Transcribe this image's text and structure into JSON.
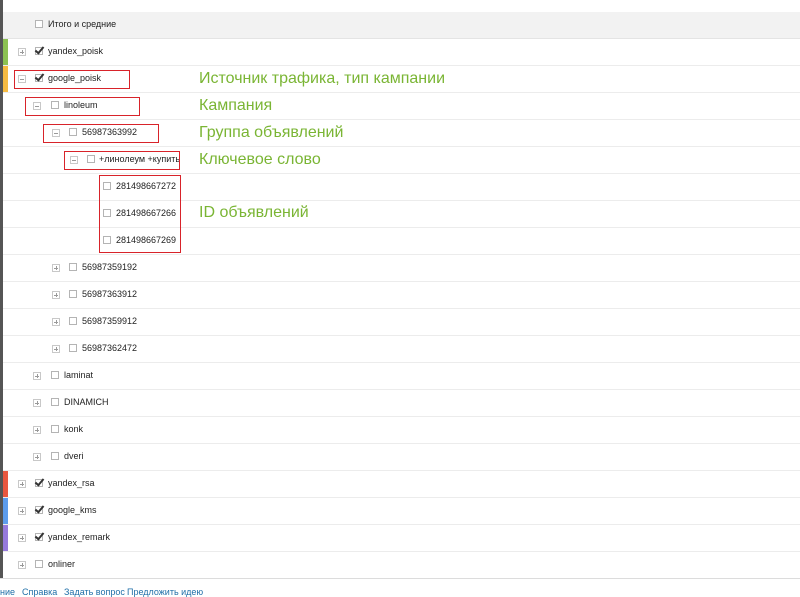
{
  "header": {
    "label": "Итого и средние",
    "checked": false
  },
  "rows": [
    {
      "id": "yandex_poisk",
      "label": "yandex_poisk",
      "level": 0,
      "expander": "plus",
      "checked": true,
      "color": "#8cc152"
    },
    {
      "id": "google_poisk",
      "label": "google_poisk",
      "level": 0,
      "expander": "minus",
      "checked": true,
      "color": "#f6bb42"
    },
    {
      "id": "linoleum",
      "label": "linoleum",
      "level": 1,
      "expander": "minus",
      "checked": false
    },
    {
      "id": "56987363992",
      "label": "56987363992",
      "level": 2,
      "expander": "minus",
      "checked": false
    },
    {
      "id": "kw",
      "label": "+линолеум +купить",
      "level": 3,
      "expander": "minus",
      "checked": false
    },
    {
      "id": "281498667272",
      "label": "281498667272",
      "level": 4,
      "expander": "none",
      "checked": false
    },
    {
      "id": "281498667266",
      "label": "281498667266",
      "level": 4,
      "expander": "none",
      "checked": false
    },
    {
      "id": "281498667269",
      "label": "281498667269",
      "level": 4,
      "expander": "none",
      "checked": false
    },
    {
      "id": "56987359192",
      "label": "56987359192",
      "level": 2,
      "expander": "plus",
      "checked": false
    },
    {
      "id": "56987363912",
      "label": "56987363912",
      "level": 2,
      "expander": "plus",
      "checked": false
    },
    {
      "id": "56987359912",
      "label": "56987359912",
      "level": 2,
      "expander": "plus",
      "checked": false
    },
    {
      "id": "56987362472",
      "label": "56987362472",
      "level": 2,
      "expander": "plus",
      "checked": false
    },
    {
      "id": "laminat",
      "label": "laminat",
      "level": 1,
      "expander": "plus",
      "checked": false
    },
    {
      "id": "DINAMICH",
      "label": "DINAMICH",
      "level": 1,
      "expander": "plus",
      "checked": false
    },
    {
      "id": "konk",
      "label": "konk",
      "level": 1,
      "expander": "plus",
      "checked": false
    },
    {
      "id": "dveri",
      "label": "dveri",
      "level": 1,
      "expander": "plus",
      "checked": false
    },
    {
      "id": "yandex_rsa",
      "label": "yandex_rsa",
      "level": 0,
      "expander": "plus",
      "checked": true,
      "color": "#e9573f"
    },
    {
      "id": "google_kms",
      "label": "google_kms",
      "level": 0,
      "expander": "plus",
      "checked": true,
      "color": "#5d9cec"
    },
    {
      "id": "yandex_remark",
      "label": "yandex_remark",
      "level": 0,
      "expander": "plus",
      "checked": true,
      "color": "#967adc"
    },
    {
      "id": "onliner",
      "label": "onliner",
      "level": 0,
      "expander": "plus",
      "checked": false
    }
  ],
  "annotations": {
    "source": "Источник трафика, тип кампании",
    "campaign": "Кампания",
    "adgroup": "Группа объявлений",
    "keyword": "Ключевое слово",
    "adids": "ID объявлений"
  },
  "footer": {
    "link_partial": "ние",
    "help": "Справка",
    "ask": "Задать вопрос",
    "idea": "Предложить идею"
  },
  "colors": {
    "annotation": "#7ab534",
    "highlight_box": "#d8232a",
    "link": "#1f6fa8"
  }
}
